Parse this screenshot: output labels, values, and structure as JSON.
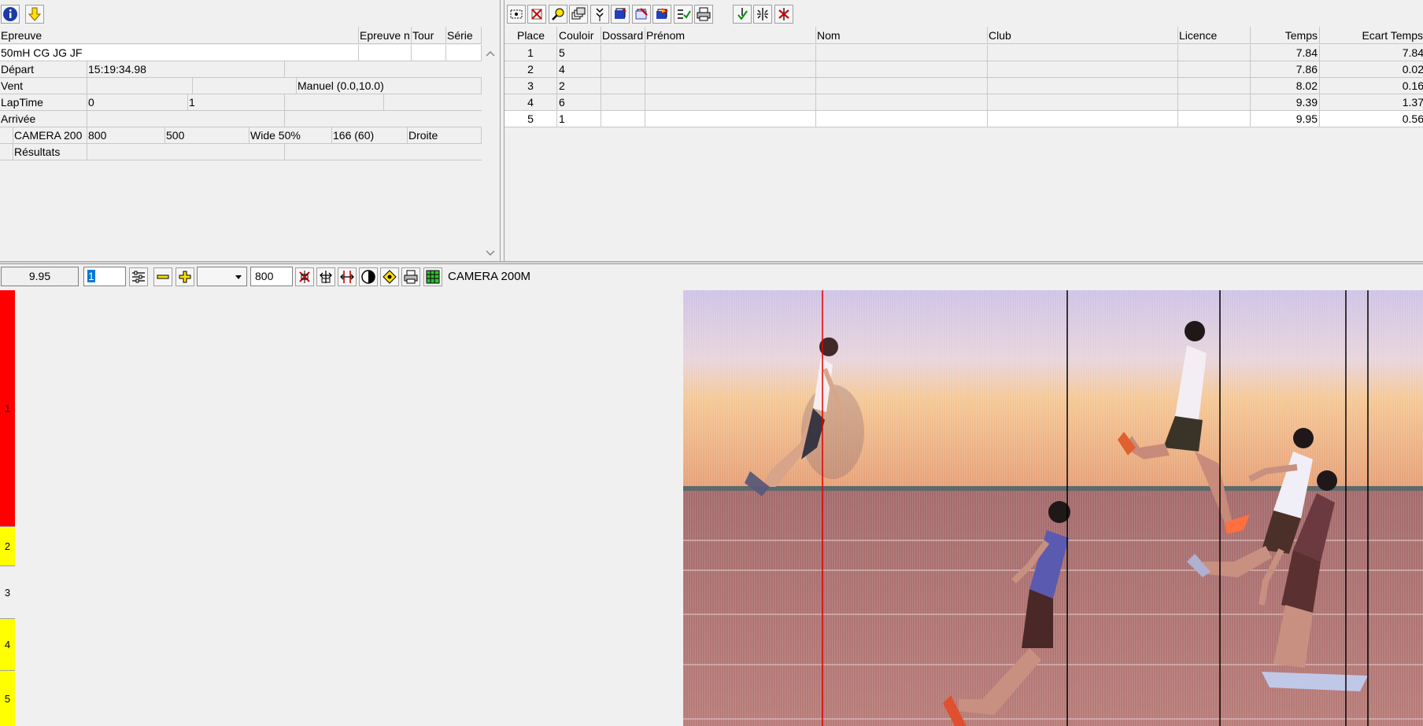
{
  "event_panel": {
    "headers": [
      "Epreuve",
      "Epreuve n",
      "Tour",
      "Série"
    ],
    "event_name": "50mH CG JG JF",
    "rows": [
      {
        "label": "Départ",
        "value": "15:19:34.98"
      },
      {
        "label": "Vent",
        "mode": "Manuel (0.0,10.0)"
      },
      {
        "label": "LapTime",
        "value": "0",
        "value2": "1"
      },
      {
        "label": "Arrivée"
      },
      {
        "camera": "CAMERA 200",
        "v1": "800",
        "v2": "500",
        "v3": "Wide 50%",
        "v4": "166  (60)",
        "v5": "Droite"
      },
      {
        "label": "Résultats"
      }
    ]
  },
  "results": {
    "columns": [
      "Place",
      "Couloir",
      "Dossard",
      "Prénom",
      "Nom",
      "Club",
      "Licence",
      "Temps",
      "Ecart Temps"
    ],
    "rows": [
      {
        "place": "1",
        "lane": "5",
        "time": "7.84",
        "gap": "7.84"
      },
      {
        "place": "2",
        "lane": "4",
        "time": "7.86",
        "gap": "0.02"
      },
      {
        "place": "3",
        "lane": "2",
        "time": "8.02",
        "gap": "0.16"
      },
      {
        "place": "4",
        "lane": "6",
        "time": "9.39",
        "gap": "1.37"
      },
      {
        "place": "5",
        "lane": "1",
        "time": "9.95",
        "gap": "0.56"
      }
    ]
  },
  "viewer_toolbar": {
    "time": "9.95",
    "frame": "1",
    "width": "800",
    "camera": "CAMERA 200M"
  },
  "lanes": [
    {
      "label": "1",
      "color": "#ff0000"
    },
    {
      "label": "2",
      "color": "#ffff00"
    },
    {
      "label": "3",
      "color": "#f0f0f0"
    },
    {
      "label": "4",
      "color": "#ffff00"
    },
    {
      "label": "5",
      "color": "#ffff00"
    }
  ]
}
